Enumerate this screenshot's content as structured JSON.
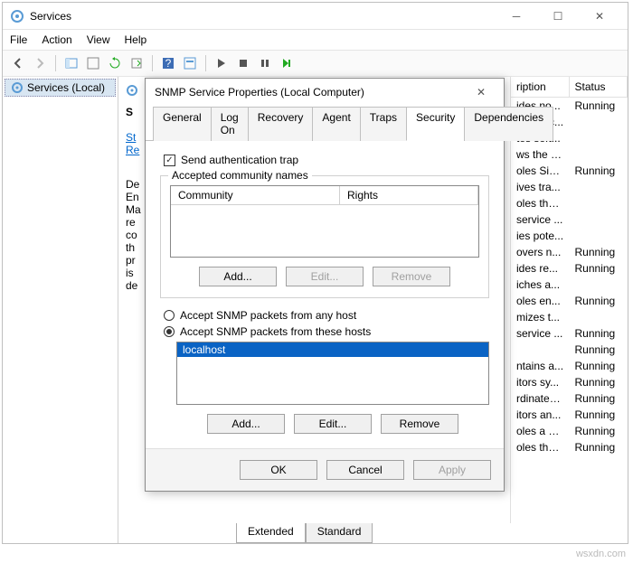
{
  "window": {
    "title": "Services",
    "menus": [
      "File",
      "Action",
      "View",
      "Help"
    ],
    "tree_item": "Services (Local)"
  },
  "detail": {
    "heading_initial": "S",
    "links_partial": [
      "St",
      "Re"
    ],
    "desc_lines": [
      "De",
      "En",
      "Ma",
      "re",
      "co",
      "th",
      "pr",
      "is",
      "de"
    ]
  },
  "services_table": {
    "columns": [
      "ription",
      "Status"
    ],
    "rows": [
      {
        "desc": "ides no...",
        "status": "Running"
      },
      {
        "desc": "ages ac...",
        "status": ""
      },
      {
        "desc": "tes soft...",
        "status": ""
      },
      {
        "desc": "ws the s...",
        "status": ""
      },
      {
        "desc": "oles Sim...",
        "status": "Running"
      },
      {
        "desc": "ives tra...",
        "status": ""
      },
      {
        "desc": "oles the ...",
        "status": ""
      },
      {
        "desc": "service ...",
        "status": ""
      },
      {
        "desc": "ies pote...",
        "status": ""
      },
      {
        "desc": "overs n...",
        "status": "Running"
      },
      {
        "desc": "ides re...",
        "status": "Running"
      },
      {
        "desc": "iches a...",
        "status": ""
      },
      {
        "desc": "oles en...",
        "status": "Running"
      },
      {
        "desc": "mizes t...",
        "status": ""
      },
      {
        "desc": "service ...",
        "status": "Running"
      },
      {
        "desc": "",
        "status": "Running"
      },
      {
        "desc": "ntains a...",
        "status": "Running"
      },
      {
        "desc": "itors sy...",
        "status": "Running"
      },
      {
        "desc": "rdinates...",
        "status": "Running"
      },
      {
        "desc": "itors an...",
        "status": "Running"
      },
      {
        "desc": "oles a us...",
        "status": "Running"
      },
      {
        "desc": "oles the ...",
        "status": "Running"
      }
    ]
  },
  "sheet_tabs": {
    "active": "Extended",
    "inactive": "Standard"
  },
  "dialog": {
    "title": "SNMP Service Properties (Local Computer)",
    "tabs": [
      "General",
      "Log On",
      "Recovery",
      "Agent",
      "Traps",
      "Security",
      "Dependencies"
    ],
    "active_tab": "Security",
    "send_auth_trap": "Send authentication trap",
    "accepted_names_group": "Accepted community names",
    "lv_columns": [
      "Community",
      "Rights"
    ],
    "btn_add": "Add...",
    "btn_edit": "Edit...",
    "btn_remove": "Remove",
    "radio_any": "Accept SNMP packets from any host",
    "radio_these": "Accept SNMP packets from these hosts",
    "host_selected": "localhost",
    "btn_ok": "OK",
    "btn_cancel": "Cancel",
    "btn_apply": "Apply"
  },
  "watermark": "wsxdn.com"
}
